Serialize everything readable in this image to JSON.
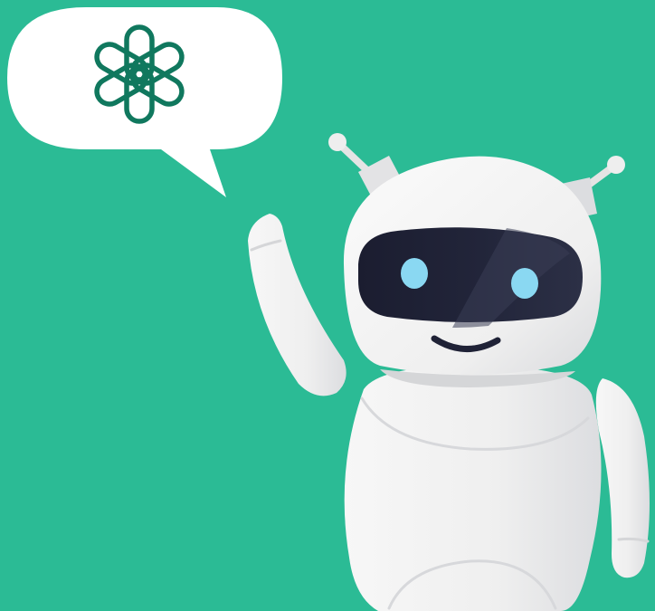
{
  "scene": {
    "background_color": "#2bbb95",
    "subject": "waving-robot",
    "speech_bubble": {
      "icon": "openai-logo-icon",
      "icon_color": "#10785e",
      "fill_color": "#ffffff"
    },
    "robot": {
      "body_color": "#eeeeee",
      "shadow_color": "#d5d6d8",
      "visor_color": "#1f2236",
      "eye_color": "#8ad8f2",
      "smile_color": "#1f2236"
    }
  }
}
